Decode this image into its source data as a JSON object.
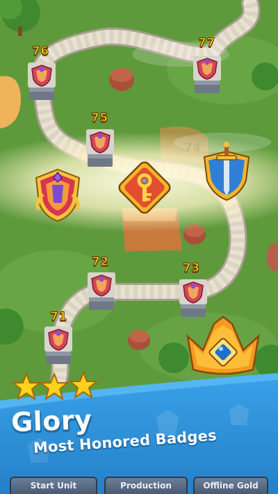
{
  "levels": [
    {
      "number": "76"
    },
    {
      "number": "77"
    },
    {
      "number": "75"
    },
    {
      "number": "74"
    },
    {
      "number": "72"
    },
    {
      "number": "73"
    },
    {
      "number": "71"
    }
  ],
  "promo": {
    "title": "Glory",
    "subtitle": "Most Honored Badges",
    "stars_shown": 3
  },
  "bottom_tabs": [
    {
      "label": "Start Unit"
    },
    {
      "label": "Production"
    },
    {
      "label": "Offline Gold"
    }
  ],
  "badges": [
    "ornate-shield-badge-icon",
    "key-diamond-badge-icon",
    "sword-shield-badge-icon",
    "crown-badge-icon"
  ],
  "colors": {
    "grass": "#5e9a3c",
    "path": "#e9e2d2",
    "level_text": "#ffc61a",
    "banner": "#2f8fd6",
    "accent_gold": "#f5a51a"
  }
}
